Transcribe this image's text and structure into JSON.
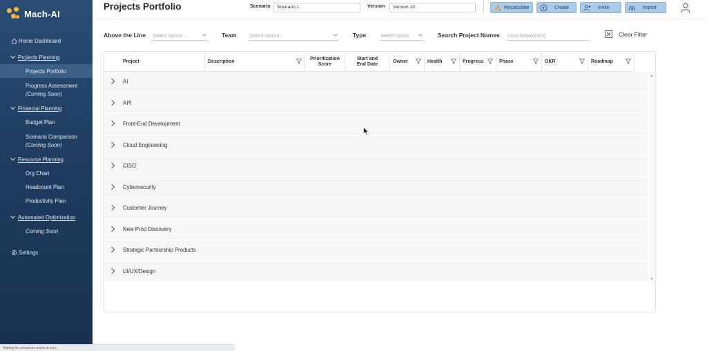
{
  "brand": {
    "name": "Mach-AI"
  },
  "sidebar": {
    "items": [
      {
        "label": "Home Dashboard",
        "kind": "top",
        "icon": "home-icon"
      },
      {
        "label": "Projects Planning",
        "kind": "section"
      },
      {
        "label": "Projects Portfolio",
        "kind": "sub",
        "active": true
      },
      {
        "label": "Progress Assessment",
        "note": "(Coming Soon)",
        "kind": "sub"
      },
      {
        "label": "Financial Planning",
        "kind": "section"
      },
      {
        "label": "Budget Plan",
        "kind": "sub"
      },
      {
        "label": "Scenario Comparison",
        "note": "(Coming Soon)",
        "kind": "sub"
      },
      {
        "label": "Resource Planning",
        "kind": "section"
      },
      {
        "label": "Org Chart",
        "kind": "sub"
      },
      {
        "label": "Headcount Plan",
        "kind": "sub"
      },
      {
        "label": "Productivity Plan",
        "kind": "sub"
      },
      {
        "label": "Automated Optimization",
        "kind": "section"
      },
      {
        "label": "Coming Soon",
        "kind": "sub-italic"
      },
      {
        "label": "Settings",
        "kind": "top",
        "icon": "gear-icon"
      }
    ],
    "status_text": "Waiting for resources.mach-ai.com..."
  },
  "header": {
    "title": "Projects Portfolio",
    "scenario_label": "Scenario",
    "scenario_value": "Scenario 1",
    "version_label": "Version",
    "version_value": "Version 10",
    "buttons": {
      "recalculate": "Recalculate",
      "create": "Create",
      "invite": "Invite",
      "import": "Import"
    }
  },
  "filters": {
    "above_line_label": "Above the Line",
    "above_line_placeholder": "Select option...",
    "team_label": "Team",
    "team_placeholder": "Select option...",
    "type_label": "Type",
    "type_placeholder": "Select optior",
    "search_label": "Search Project Names",
    "search_placeholder": "Input keyword(s)",
    "clear_label": "Clear Filter"
  },
  "table": {
    "columns": {
      "project": "Project",
      "description": "Description",
      "prioritization": "Prioritization Score",
      "dates": "Start and End Date",
      "owner": "Owner",
      "health": "Health",
      "progress": "Progress",
      "phase": "Phase",
      "okr": "OKR",
      "roadmap": "Roadmap"
    },
    "rows": [
      "AI",
      "API",
      "Front-End Development",
      "Cloud Engineering",
      "CISO",
      "Cybersecurity",
      "Customer Journey",
      "New Prod Discovery",
      "Strategic Partnership Products",
      "UI/UX/Design"
    ]
  },
  "colors": {
    "sidebar": "#1f3e62",
    "button_bg": "#a9cbe8",
    "logo_accent": "#f4b53f"
  }
}
